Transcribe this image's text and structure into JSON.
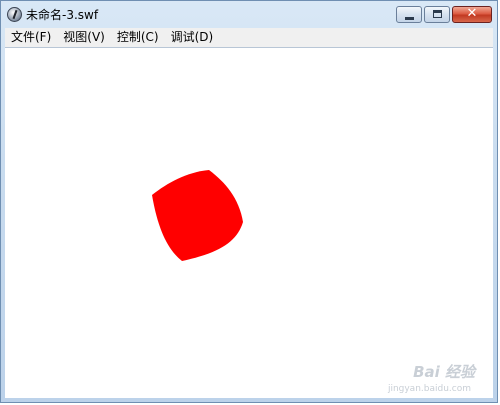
{
  "window": {
    "title": "未命名-3.swf",
    "close_glyph": "✕"
  },
  "menu": {
    "items": [
      {
        "label": "文件(F)"
      },
      {
        "label": "视图(V)"
      },
      {
        "label": "控制(C)"
      },
      {
        "label": "调试(D)"
      }
    ]
  },
  "stage": {
    "shape_color": "#ff0000",
    "background_color": "#ffffff"
  },
  "watermark": {
    "brand": "Bai 经验",
    "site": "jingyan.baidu.com"
  }
}
